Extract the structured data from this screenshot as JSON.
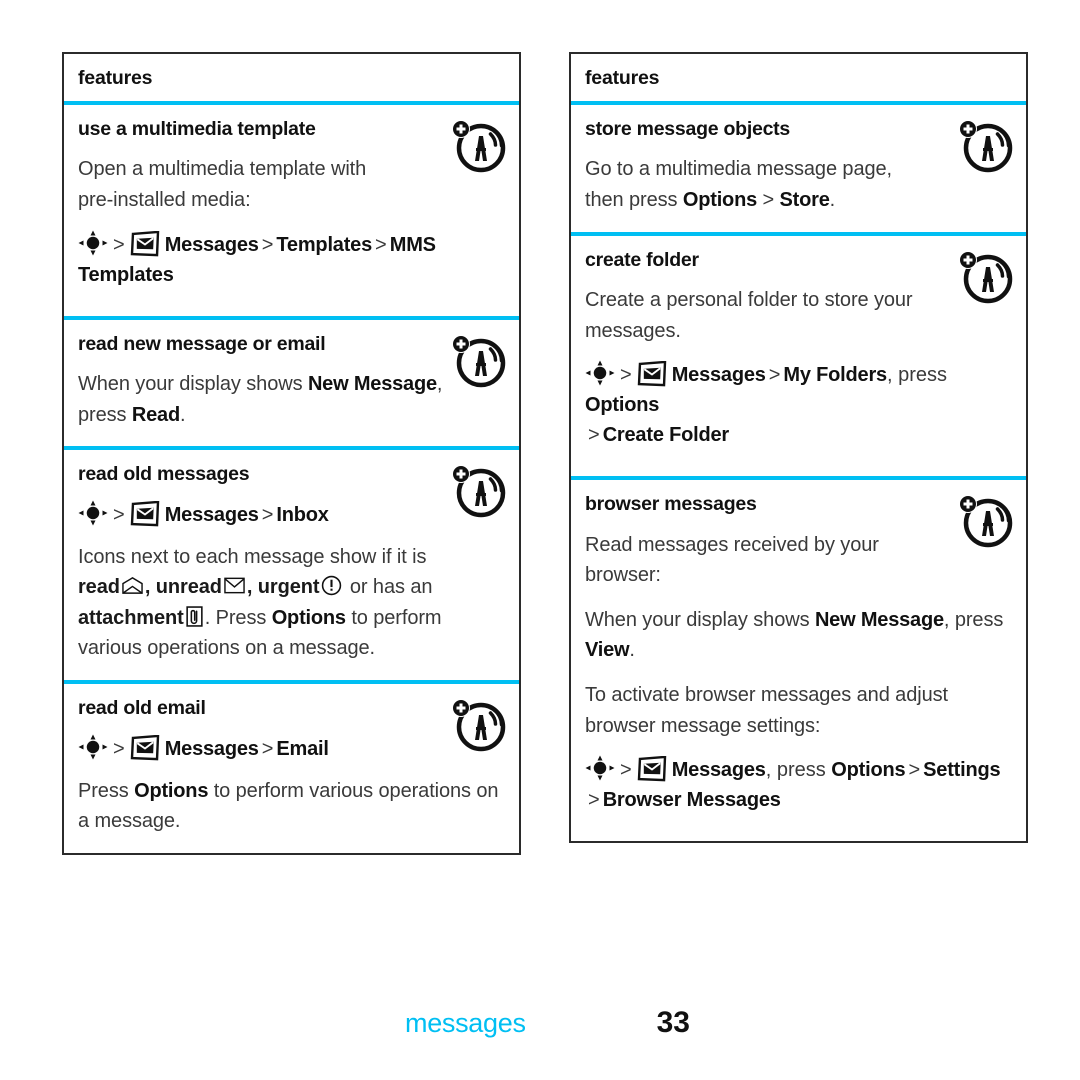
{
  "footer": {
    "chapter": "messages",
    "page_number": "33",
    "chapter_color": "#00BFF3"
  },
  "theme": {
    "divider_color": "#00BFF3",
    "border_color": "#2b2b2b",
    "body_text_color": "#3a3a3a"
  },
  "left_column": {
    "header": "features",
    "sections": [
      {
        "title": "use a multimedia template",
        "badge_icon": "antenna-plus-icon",
        "body_1": "Open a multimedia template with",
        "body_2": "pre-installed media:",
        "nav": {
          "key_icon": "nav-key-icon",
          "sep1": ">",
          "app_icon": "messages-envelope-icon",
          "app": "Messages",
          "sep2": ">",
          "item1": "Templates",
          "sep3": ">",
          "item2": "MMS Templates"
        }
      },
      {
        "title": "read new message or email",
        "badge_icon": "antenna-plus-icon",
        "body_pre": "When your display shows ",
        "body_ui_1": "New Message",
        "body_mid": ",",
        "body_line2_pre": "press ",
        "body_ui_2": "Read",
        "body_end": "."
      },
      {
        "title": "read old messages",
        "badge_icon": "antenna-plus-icon",
        "nav": {
          "key_icon": "nav-key-icon",
          "sep1": ">",
          "app_icon": "messages-envelope-icon",
          "app": "Messages",
          "sep2": ">",
          "item1": "Inbox"
        },
        "body_l1": "Icons next to each message show if it is",
        "body_read": "read",
        "read_icon": "open-envelope-icon",
        "comma1": ", ",
        "body_unread": "unread",
        "unread_icon": "closed-envelope-icon",
        "comma2": ", ",
        "body_urgent": "urgent",
        "urgent_icon": "exclamation-circle-icon",
        "body_or": " or has an",
        "body_attachment": "attachment",
        "attachment_icon": "paperclip-box-icon",
        "body_press": ". Press ",
        "body_ui_options": "Options",
        "body_perform": " to perform",
        "body_l4": "various operations on a message."
      },
      {
        "title": "read old email",
        "badge_icon": "antenna-plus-icon",
        "nav": {
          "key_icon": "nav-key-icon",
          "sep1": ">",
          "app_icon": "messages-envelope-icon",
          "app": "Messages",
          "sep2": ">",
          "item1": "Email"
        },
        "body_pre": "Press ",
        "body_ui": "Options",
        "body_post": " to perform various operations on",
        "body_l2": "a message."
      }
    ]
  },
  "right_column": {
    "header": "features",
    "sections": [
      {
        "title": "store message objects",
        "badge_icon": "antenna-plus-icon",
        "body_l1": "Go to a multimedia message page,",
        "body_l2_pre": "then press ",
        "body_ui_1": "Options",
        "body_sep": " > ",
        "body_ui_2": "Store",
        "body_end": "."
      },
      {
        "title": "create folder",
        "badge_icon": "antenna-plus-icon",
        "body_l1": "Create a personal folder to store your",
        "body_l2": "messages.",
        "nav": {
          "key_icon": "nav-key-icon",
          "sep1": ">",
          "app_icon": "messages-envelope-icon",
          "app": "Messages",
          "sep2": ">",
          "item1": "My Folders",
          "press": ", press ",
          "item2": "Options",
          "sep3": ">",
          "item3": "Create Folder"
        }
      },
      {
        "title": "browser messages",
        "badge_icon": "antenna-plus-icon",
        "body_a1": "Read messages received by your",
        "body_a2": "browser:",
        "body_b_pre": "When your display shows ",
        "body_b_ui1": "New Message",
        "body_b_mid": ", press",
        "body_b_ui2": "View",
        "body_b_end": ".",
        "body_c1": "To activate browser messages and adjust",
        "body_c2": "browser message settings:",
        "nav": {
          "key_icon": "nav-key-icon",
          "sep1": ">",
          "app_icon": "messages-envelope-icon",
          "app": "Messages",
          "press": ", press ",
          "item1": "Options",
          "sep2": ">",
          "item2": "Settings",
          "sep3": ">",
          "item3": "Browser Messages"
        }
      }
    ]
  }
}
